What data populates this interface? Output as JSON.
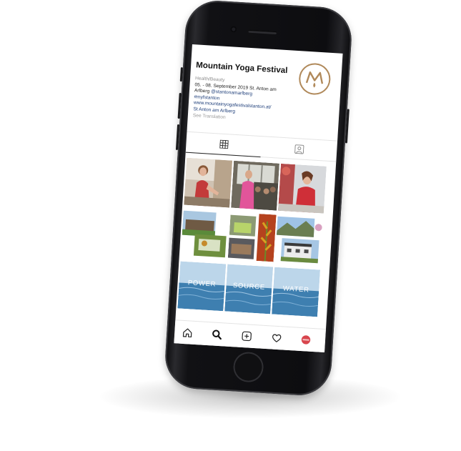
{
  "profile": {
    "name": "Mountain Yoga Festival",
    "category": "Health/Beauty",
    "dates": "05. - 08. September 2019 St. Anton am",
    "location_prefix": "Arlberg ",
    "mention": "@stantonamarlberg",
    "hashtag": "#myfstanton",
    "website": "www.mountainyogafestivalstanton.at/",
    "address": "St Anton am Arlberg",
    "see_translation": "See Translation"
  },
  "tabs": [
    {
      "icon": "grid-icon",
      "active": true
    },
    {
      "icon": "tagged-person-icon",
      "active": false
    }
  ],
  "grid": {
    "banner_words": [
      "POWER",
      "SOURCE",
      "WATER"
    ]
  },
  "nav": [
    "home-icon",
    "search-icon",
    "add-post-icon",
    "heart-icon",
    "profile-avatar-icon"
  ],
  "colors": {
    "logo_gold": "#b0895a",
    "link_blue": "#1f3f7a",
    "water_blue": "#3e7fb0"
  }
}
